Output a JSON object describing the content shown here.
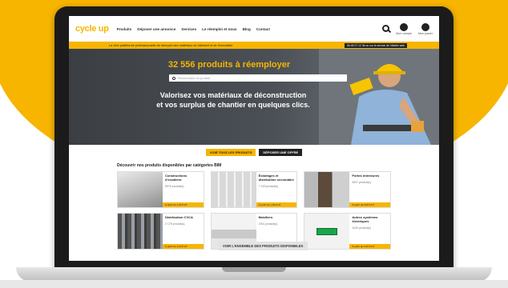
{
  "site": {
    "logo": "cycle up",
    "nav": [
      "Produits",
      "Déposer une annonce",
      "Services",
      "Le réemploi et nous",
      "Blog",
      "Contact"
    ],
    "header_icons": {
      "search": "search-icon",
      "account_label": "Mon compte",
      "cart_label": "Mon panier"
    },
    "info_bar": {
      "text": "La 1ère plateforme professionnelle de réemploi des matériaux du bâtiment et de l'immobilier",
      "right": "06 48 07 12 36 ou sur le service de l'Atelier web"
    }
  },
  "hero": {
    "title": "32 556 produits à réemployer",
    "search_placeholder": "Recherchez un produit",
    "subtitle_line1": "Valorisez vos matériaux de déconstruction",
    "subtitle_line2": "et vos surplus de chantier en quelques clics."
  },
  "buttons": {
    "view_all": "VOIR TOUS LES PRODUITS",
    "post_offer": "DÉPOSER UNE OFFRE",
    "see_more": "VOIR L'ENSEMBLE DES PRODUITS DISPONIBLES"
  },
  "categories_title": "Découvrir nos produits disponibles par catégories BIM",
  "categories": [
    {
      "name": "Constructions d'escaliers",
      "count": "5076 produit(s)",
      "price": "À partir de 1,00 € HT",
      "image": "stairs"
    },
    {
      "name": "Éclairages et distribution secondaire",
      "count": "7 415 produit(s)",
      "price": "À partir de 1,00 € HT",
      "image": "ceiling"
    },
    {
      "name": "Portes intérieures",
      "count": "3007 produit(s)",
      "price": "À partir de 5,00 € HT",
      "image": "door"
    },
    {
      "name": "Distribution CVCA",
      "count": "2 178 produit(s)",
      "price": "À partir de 1,00 € HT",
      "image": "pipes"
    },
    {
      "name": "Mobiliers",
      "count": "1901 produit(s)",
      "price": "À partir de 1,00 € HT",
      "image": "office"
    },
    {
      "name": "Autres systèmes électriques",
      "count": "1040 produit(s)",
      "price": "À partir de 1,00 € HT",
      "image": "exit-sign"
    }
  ],
  "colors": {
    "brand_yellow": "#f7b500",
    "dark": "#1b1b1b"
  }
}
